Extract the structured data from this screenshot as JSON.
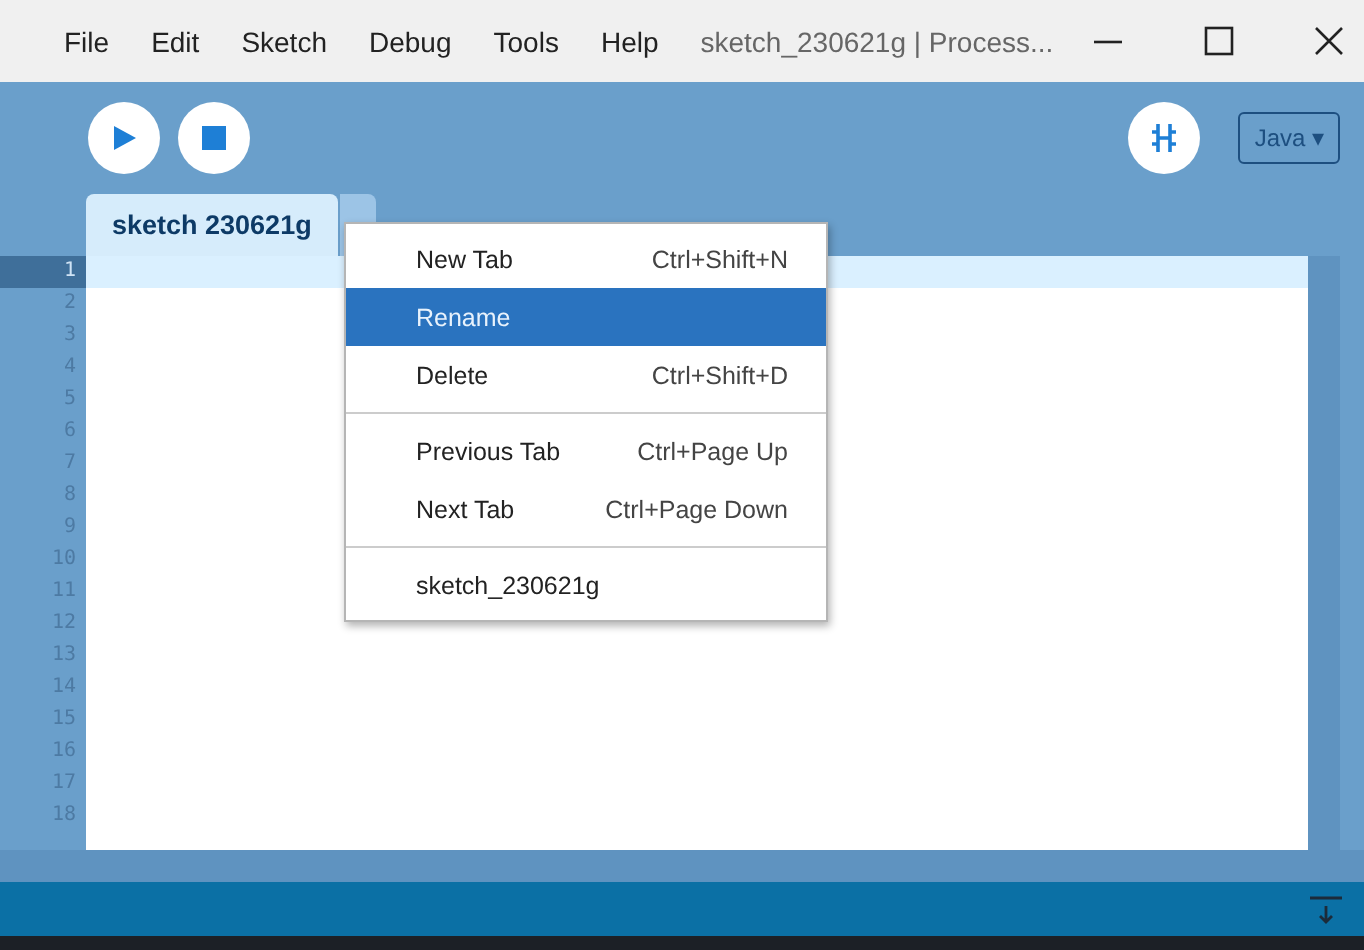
{
  "window": {
    "title": "sketch_230621g | Process...",
    "menu": [
      "File",
      "Edit",
      "Sketch",
      "Debug",
      "Tools",
      "Help"
    ]
  },
  "toolbar": {
    "mode": "Java",
    "mode_caret": "▾"
  },
  "tabs": [
    {
      "label": "sketch 230621g",
      "selected": true
    }
  ],
  "editor": {
    "lines": [
      {
        "number": "1",
        "current": true
      },
      {
        "number": "2",
        "current": false
      },
      {
        "number": "3",
        "current": false
      },
      {
        "number": "4",
        "current": false
      },
      {
        "number": "5",
        "current": false
      },
      {
        "number": "6",
        "current": false
      },
      {
        "number": "7",
        "current": false
      },
      {
        "number": "8",
        "current": false
      },
      {
        "number": "9",
        "current": false
      },
      {
        "number": "10",
        "current": false
      },
      {
        "number": "11",
        "current": false
      },
      {
        "number": "12",
        "current": false
      },
      {
        "number": "13",
        "current": false
      },
      {
        "number": "14",
        "current": false
      },
      {
        "number": "15",
        "current": false
      },
      {
        "number": "16",
        "current": false
      },
      {
        "number": "17",
        "current": false
      },
      {
        "number": "18",
        "current": false
      }
    ]
  },
  "context_menu": {
    "groups": [
      [
        {
          "label": "New Tab",
          "shortcut": "Ctrl+Shift+N",
          "selected": false
        },
        {
          "label": "Rename",
          "selected": true
        },
        {
          "label": "Delete",
          "shortcut": "Ctrl+Shift+D",
          "selected": false
        }
      ],
      [
        {
          "label": "Previous Tab",
          "shortcut": "Ctrl+Page Up",
          "selected": false
        },
        {
          "label": "Next Tab",
          "shortcut": "Ctrl+Page Down",
          "selected": false
        }
      ],
      [
        {
          "label": "sketch_230621g",
          "selected": false
        }
      ]
    ]
  }
}
